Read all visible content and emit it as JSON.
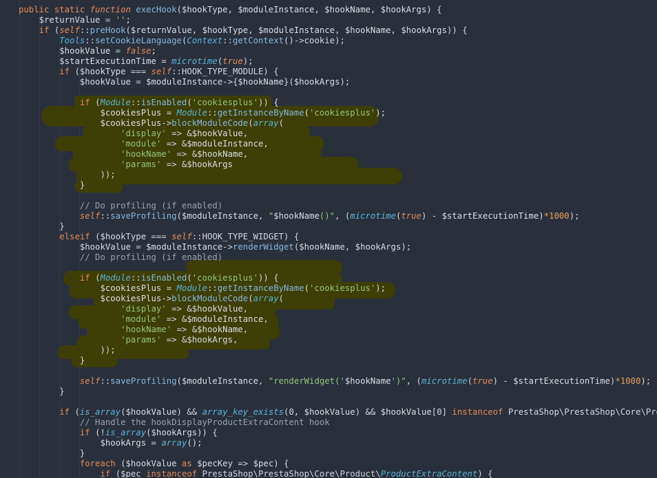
{
  "editor": {
    "language": "php",
    "colors": {
      "background": "#2a303b",
      "highlight": "#3e3f06",
      "keyword": "#e08a5e",
      "string": "#94c47d",
      "class": "#5cb1d8"
    },
    "lines": [
      [
        [
          "kw",
          "public static "
        ],
        [
          "self",
          "function "
        ],
        [
          "fn",
          "execHook"
        ],
        [
          "op",
          "("
        ],
        [
          "var",
          "$hookType"
        ],
        [
          "op",
          ", "
        ],
        [
          "var",
          "$moduleInstance"
        ],
        [
          "op",
          ", "
        ],
        [
          "var",
          "$hookName"
        ],
        [
          "op",
          ", "
        ],
        [
          "var",
          "$hookArgs"
        ],
        [
          "op",
          ") {"
        ]
      ],
      [
        [
          "op",
          "    "
        ],
        [
          "var",
          "$returnValue"
        ],
        [
          "op",
          " = "
        ],
        [
          "str",
          "''"
        ],
        [
          "op",
          ";"
        ]
      ],
      [
        [
          "op",
          "    "
        ],
        [
          "kw",
          "if "
        ],
        [
          "op",
          "("
        ],
        [
          "self",
          "self"
        ],
        [
          "op",
          "::"
        ],
        [
          "fn",
          "preHook"
        ],
        [
          "op",
          "("
        ],
        [
          "var",
          "$returnValue"
        ],
        [
          "op",
          ", "
        ],
        [
          "var",
          "$hookType"
        ],
        [
          "op",
          ", "
        ],
        [
          "var",
          "$moduleInstance"
        ],
        [
          "op",
          ", "
        ],
        [
          "var",
          "$hookName"
        ],
        [
          "op",
          ", "
        ],
        [
          "var",
          "$hookArgs"
        ],
        [
          "op",
          ")) {"
        ]
      ],
      [
        [
          "op",
          "        "
        ],
        [
          "cls",
          "Tools"
        ],
        [
          "op",
          "::"
        ],
        [
          "fn",
          "setCookieLanguage"
        ],
        [
          "op",
          "("
        ],
        [
          "cls",
          "Context"
        ],
        [
          "op",
          "::"
        ],
        [
          "fn",
          "getContext"
        ],
        [
          "op",
          "()->"
        ],
        [
          "op",
          "cookie"
        ],
        [
          "op",
          ");"
        ]
      ],
      [
        [
          "op",
          "        "
        ],
        [
          "var",
          "$hookValue"
        ],
        [
          "op",
          " = "
        ],
        [
          "bool",
          "false"
        ],
        [
          "op",
          ";"
        ]
      ],
      [
        [
          "op",
          "        "
        ],
        [
          "var",
          "$startExecutionTime"
        ],
        [
          "op",
          " = "
        ],
        [
          "itf",
          "microtime"
        ],
        [
          "op",
          "("
        ],
        [
          "bool",
          "true"
        ],
        [
          "op",
          ");"
        ]
      ],
      [
        [
          "op",
          "        "
        ],
        [
          "kw",
          "if "
        ],
        [
          "op",
          "("
        ],
        [
          "var",
          "$hookType"
        ],
        [
          "op",
          " === "
        ],
        [
          "self",
          "self"
        ],
        [
          "op",
          "::HOOK_TYPE_MODULE) {"
        ]
      ],
      [
        [
          "op",
          "            "
        ],
        [
          "var",
          "$hookValue"
        ],
        [
          "op",
          " = "
        ],
        [
          "var",
          "$moduleInstance"
        ],
        [
          "op",
          "->{"
        ],
        [
          "var",
          "$hookName"
        ],
        [
          "op",
          "}("
        ],
        [
          "var",
          "$hookArgs"
        ],
        [
          "op",
          ");"
        ]
      ],
      [
        [
          "op",
          ""
        ]
      ],
      [
        [
          "op",
          "            "
        ],
        [
          "kw",
          "if "
        ],
        [
          "op",
          "("
        ],
        [
          "cls",
          "Module"
        ],
        [
          "op",
          "::"
        ],
        [
          "fn",
          "isEnabled"
        ],
        [
          "op",
          "("
        ],
        [
          "str",
          "'cookiesplus'"
        ],
        [
          "op",
          ")) {"
        ]
      ],
      [
        [
          "op",
          "                "
        ],
        [
          "var",
          "$cookiesPlus"
        ],
        [
          "op",
          " = "
        ],
        [
          "cls",
          "Module"
        ],
        [
          "op",
          "::"
        ],
        [
          "fn",
          "getInstanceByName"
        ],
        [
          "op",
          "("
        ],
        [
          "str",
          "'cookiesplus'"
        ],
        [
          "op",
          ");"
        ]
      ],
      [
        [
          "op",
          "                "
        ],
        [
          "var",
          "$cookiesPlus"
        ],
        [
          "op",
          "->"
        ],
        [
          "fn",
          "blockModuleCode"
        ],
        [
          "op",
          "("
        ],
        [
          "itf",
          "array"
        ],
        [
          "op",
          "("
        ]
      ],
      [
        [
          "op",
          "                    "
        ],
        [
          "str",
          "'display'"
        ],
        [
          "op",
          " => &"
        ],
        [
          "var",
          "$hookValue"
        ],
        [
          "op",
          ","
        ]
      ],
      [
        [
          "op",
          "                    "
        ],
        [
          "str",
          "'module'"
        ],
        [
          "op",
          " => &"
        ],
        [
          "var",
          "$moduleInstance"
        ],
        [
          "op",
          ","
        ]
      ],
      [
        [
          "op",
          "                    "
        ],
        [
          "str",
          "'hookName'"
        ],
        [
          "op",
          " => &"
        ],
        [
          "var",
          "$hookName"
        ],
        [
          "op",
          ","
        ]
      ],
      [
        [
          "op",
          "                    "
        ],
        [
          "str",
          "'params'"
        ],
        [
          "op",
          " => &"
        ],
        [
          "var",
          "$hookArgs"
        ]
      ],
      [
        [
          "op",
          "                ));"
        ]
      ],
      [
        [
          "op",
          "            }"
        ]
      ],
      [
        [
          "op",
          ""
        ]
      ],
      [
        [
          "op",
          "            "
        ],
        [
          "cm",
          "// Do profiling (if enabled)"
        ]
      ],
      [
        [
          "op",
          "            "
        ],
        [
          "self",
          "self"
        ],
        [
          "op",
          "::"
        ],
        [
          "fn",
          "saveProfiling"
        ],
        [
          "op",
          "("
        ],
        [
          "var",
          "$moduleInstance"
        ],
        [
          "op",
          ", "
        ],
        [
          "str",
          "\""
        ],
        [
          "var",
          "$hookName"
        ],
        [
          "str",
          "()\""
        ],
        [
          "op",
          ", ("
        ],
        [
          "itf",
          "microtime"
        ],
        [
          "op",
          "("
        ],
        [
          "bool",
          "true"
        ],
        [
          "op",
          ") - "
        ],
        [
          "var",
          "$startExecutionTime"
        ],
        [
          "op",
          ")"
        ],
        [
          "num",
          "*1000"
        ],
        [
          "op",
          ");"
        ]
      ],
      [
        [
          "op",
          "        }"
        ]
      ],
      [
        [
          "op",
          "        "
        ],
        [
          "kw",
          "elseif "
        ],
        [
          "op",
          "("
        ],
        [
          "var",
          "$hookType"
        ],
        [
          "op",
          " === "
        ],
        [
          "self",
          "self"
        ],
        [
          "op",
          "::HOOK_TYPE_WIDGET) {"
        ]
      ],
      [
        [
          "op",
          "            "
        ],
        [
          "var",
          "$hookValue"
        ],
        [
          "op",
          " = "
        ],
        [
          "var",
          "$moduleInstance"
        ],
        [
          "op",
          "->"
        ],
        [
          "fn",
          "renderWidget"
        ],
        [
          "op",
          "("
        ],
        [
          "var",
          "$hookName"
        ],
        [
          "op",
          ", "
        ],
        [
          "var",
          "$hookArgs"
        ],
        [
          "op",
          ");"
        ]
      ],
      [
        [
          "op",
          "            "
        ],
        [
          "cm",
          "// Do profiling (if enabled)"
        ]
      ],
      [
        [
          "op",
          ""
        ]
      ],
      [
        [
          "op",
          "            "
        ],
        [
          "kw",
          "if "
        ],
        [
          "op",
          "("
        ],
        [
          "cls",
          "Module"
        ],
        [
          "op",
          "::"
        ],
        [
          "fn",
          "isEnabled"
        ],
        [
          "op",
          "("
        ],
        [
          "str",
          "'cookiesplus'"
        ],
        [
          "op",
          ")) {"
        ]
      ],
      [
        [
          "op",
          "                "
        ],
        [
          "var",
          "$cookiesPlus"
        ],
        [
          "op",
          " = "
        ],
        [
          "cls",
          "Module"
        ],
        [
          "op",
          "::"
        ],
        [
          "fn",
          "getInstanceByName"
        ],
        [
          "op",
          "("
        ],
        [
          "str",
          "'cookiesplus'"
        ],
        [
          "op",
          ");"
        ]
      ],
      [
        [
          "op",
          "                "
        ],
        [
          "var",
          "$cookiesPlus"
        ],
        [
          "op",
          "->"
        ],
        [
          "fn",
          "blockModuleCode"
        ],
        [
          "op",
          "("
        ],
        [
          "itf",
          "array"
        ],
        [
          "op",
          "("
        ]
      ],
      [
        [
          "op",
          "                    "
        ],
        [
          "str",
          "'display'"
        ],
        [
          "op",
          " => &"
        ],
        [
          "var",
          "$hookValue"
        ],
        [
          "op",
          ","
        ]
      ],
      [
        [
          "op",
          "                    "
        ],
        [
          "str",
          "'module'"
        ],
        [
          "op",
          " => &"
        ],
        [
          "var",
          "$moduleInstance"
        ],
        [
          "op",
          ","
        ]
      ],
      [
        [
          "op",
          "                    "
        ],
        [
          "str",
          "'hookName'"
        ],
        [
          "op",
          " => &"
        ],
        [
          "var",
          "$hookName"
        ],
        [
          "op",
          ","
        ]
      ],
      [
        [
          "op",
          "                    "
        ],
        [
          "str",
          "'params'"
        ],
        [
          "op",
          " => &"
        ],
        [
          "var",
          "$hookArgs"
        ],
        [
          "op",
          ","
        ]
      ],
      [
        [
          "op",
          "                ));"
        ]
      ],
      [
        [
          "op",
          "            }"
        ]
      ],
      [
        [
          "op",
          ""
        ]
      ],
      [
        [
          "op",
          "            "
        ],
        [
          "self",
          "self"
        ],
        [
          "op",
          "::"
        ],
        [
          "fn",
          "saveProfiling"
        ],
        [
          "op",
          "("
        ],
        [
          "var",
          "$moduleInstance"
        ],
        [
          "op",
          ", "
        ],
        [
          "str",
          "\"renderWidget('"
        ],
        [
          "var",
          "$hookName"
        ],
        [
          "str",
          "')\""
        ],
        [
          "op",
          ", ("
        ],
        [
          "itf",
          "microtime"
        ],
        [
          "op",
          "("
        ],
        [
          "bool",
          "true"
        ],
        [
          "op",
          ") - "
        ],
        [
          "var",
          "$startExecutionTime"
        ],
        [
          "op",
          ")"
        ],
        [
          "num",
          "*1000"
        ],
        [
          "op",
          ");"
        ]
      ],
      [
        [
          "op",
          "        }"
        ]
      ],
      [
        [
          "op",
          ""
        ]
      ],
      [
        [
          "op",
          "        "
        ],
        [
          "kw",
          "if "
        ],
        [
          "op",
          "("
        ],
        [
          "itf",
          "is_array"
        ],
        [
          "op",
          "("
        ],
        [
          "var",
          "$hookValue"
        ],
        [
          "op",
          ") && "
        ],
        [
          "itf",
          "array_key_exists"
        ],
        [
          "op",
          "(0, "
        ],
        [
          "var",
          "$hookValue"
        ],
        [
          "op",
          ") && "
        ],
        [
          "var",
          "$hookValue"
        ],
        [
          "op",
          "[0] "
        ],
        [
          "kw",
          "instanceof "
        ],
        [
          "op",
          "PrestaShop\\PrestaShop\\Core\\Product"
        ]
      ],
      [
        [
          "op",
          "            "
        ],
        [
          "cm",
          "// Handle the hookDisplayProductExtraContent hook"
        ]
      ],
      [
        [
          "op",
          "            "
        ],
        [
          "kw",
          "if "
        ],
        [
          "op",
          "(!"
        ],
        [
          "itf",
          "is_array"
        ],
        [
          "op",
          "("
        ],
        [
          "var",
          "$hookArgs"
        ],
        [
          "op",
          ")) {"
        ]
      ],
      [
        [
          "op",
          "                "
        ],
        [
          "var",
          "$hookArgs"
        ],
        [
          "op",
          " = "
        ],
        [
          "itf",
          "array"
        ],
        [
          "op",
          "();"
        ]
      ],
      [
        [
          "op",
          "            }"
        ]
      ],
      [
        [
          "op",
          "            "
        ],
        [
          "kw",
          "foreach "
        ],
        [
          "op",
          "("
        ],
        [
          "var",
          "$hookValue"
        ],
        [
          "kw",
          " as "
        ],
        [
          "var",
          "$pecKey"
        ],
        [
          "op",
          " => "
        ],
        [
          "var",
          "$pec"
        ],
        [
          "op",
          ") {"
        ]
      ],
      [
        [
          "op",
          "                "
        ],
        [
          "kw",
          "if "
        ],
        [
          "op",
          "("
        ],
        [
          "var",
          "$pec"
        ],
        [
          "kw",
          " instanceof "
        ],
        [
          "op",
          "PrestaShop\\PrestaShop\\Core\\Product\\"
        ],
        [
          "cls",
          "ProductExtraContent"
        ],
        [
          "op",
          ") {"
        ]
      ]
    ]
  }
}
